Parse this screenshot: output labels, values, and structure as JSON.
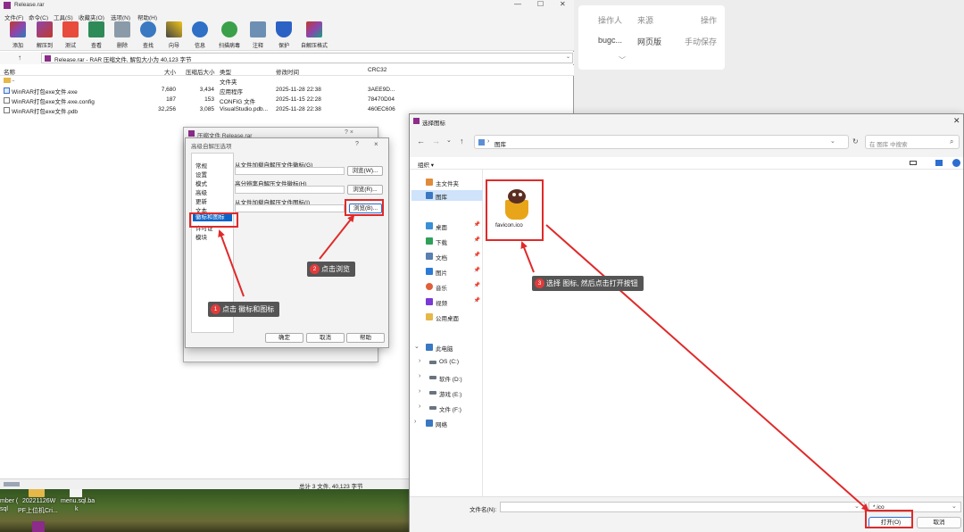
{
  "background": {
    "headers": [
      "操作人",
      "来源",
      "操作"
    ],
    "row": [
      "bugc...",
      "网页版",
      "手动保存"
    ]
  },
  "winrar": {
    "title": "Release.rar",
    "menu": [
      "文件(F)",
      "命令(C)",
      "工具(S)",
      "收藏夹(O)",
      "选项(N)",
      "帮助(H)"
    ],
    "toolbar": [
      "添加",
      "解压到",
      "测试",
      "查看",
      "删除",
      "查找",
      "向导",
      "信息",
      "扫描病毒",
      "注释",
      "保护",
      "自解压格式"
    ],
    "address": "Release.rar - RAR 压缩文件, 解包大小为 40,123 字节",
    "columns": [
      "名称",
      "大小",
      "压缩后大小",
      "类型",
      "修改时间",
      "CRC32"
    ],
    "files": [
      {
        "name": "..",
        "size": "",
        "packed": "",
        "type": "文件夹",
        "modified": "",
        "crc": ""
      },
      {
        "name": "WinRAR打包exe文件.exe",
        "size": "7,680",
        "packed": "3,434",
        "type": "应用程序",
        "modified": "2025-11-28 22:38",
        "crc": "3AEE9D..."
      },
      {
        "name": "WinRAR打包exe文件.exe.config",
        "size": "187",
        "packed": "153",
        "type": "CONFIG 文件",
        "modified": "2025-11-15 22:28",
        "crc": "78470D04"
      },
      {
        "name": "WinRAR打包exe文件.pdb",
        "size": "32,256",
        "packed": "3,085",
        "type": "VisualStudio.pdb...",
        "modified": "2025-11-28 22:38",
        "crc": "460EC606"
      }
    ],
    "status": "总计 3 文件, 40,123 字节"
  },
  "desktop": {
    "labels": [
      "mber (",
      "20221126W",
      "menu.sql.ba",
      "sql",
      "PF上位机Cri...",
      "k"
    ]
  },
  "sfx_back": {
    "title": "压缩文件 Release.rar",
    "controls": "? ×"
  },
  "sfx": {
    "title": "高级自解压选项",
    "help_glyph": "?",
    "close_glyph": "×",
    "categories": [
      "常规",
      "设置",
      "模式",
      "高级",
      "更新",
      "文本",
      "徽标和图标",
      "许可证",
      "模块"
    ],
    "labels": [
      "从文件加载自解压文件徽标(G)",
      "高分辨率自解压文件徽标(H)",
      "从文件加载自解压文件图标(I)"
    ],
    "browse": [
      "浏览(W)...",
      "浏览(R)...",
      "浏览(B)..."
    ],
    "buttons": [
      "确定",
      "取消",
      "帮助"
    ]
  },
  "file_dialog": {
    "title": "选择图标",
    "breadcrumb": "图库",
    "search_placeholder": "在 图库 中搜索",
    "organize": "组织 ▾",
    "sidebar": {
      "quick": [
        "主文件夹",
        "图库"
      ],
      "pinned": [
        "桌面",
        "下载",
        "文档",
        "图片",
        "音乐",
        "视频",
        "公用桌面"
      ],
      "pc": [
        "此电脑",
        "OS (C:)",
        "软件 (D:)",
        "游戏 (E:)",
        "文件 (F:)",
        "网络"
      ]
    },
    "file": {
      "name": "favicon.ico"
    },
    "filename_label": "文件名(N):",
    "filter": "*.ico",
    "open": "打开(O)",
    "cancel": "取消"
  },
  "callouts": [
    "点击 徽标和图标",
    "点击浏览",
    "选择 图标, 然后点击打开按钮"
  ],
  "colors": {
    "accent": "#0a64c8",
    "annotation": "#e02a2a",
    "callout": "#555555"
  }
}
